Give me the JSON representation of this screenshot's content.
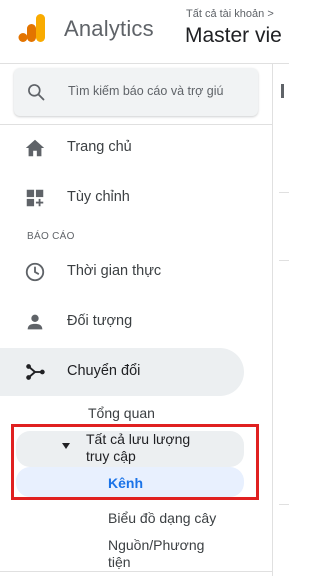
{
  "header": {
    "app_name": "Analytics",
    "account_breadcrumb": "Tất cả tài khoản >",
    "account_name": "Master vie"
  },
  "search": {
    "placeholder": "Tìm kiếm báo cáo và trợ giú",
    "icon": "search-icon"
  },
  "nav": {
    "items": [
      {
        "label": "Trang chủ",
        "icon": "home-icon"
      },
      {
        "label": "Tùy chỉnh",
        "icon": "customize-dashboard-icon"
      }
    ],
    "section_label": "BÁO CÁO",
    "reports": [
      {
        "label": "Thời gian thực",
        "icon": "clock-icon"
      },
      {
        "label": "Đối tượng",
        "icon": "person-icon"
      },
      {
        "label": "Chuyển đổi",
        "icon": "acquisition-icon",
        "active": true
      }
    ]
  },
  "acquisition": {
    "overview": "Tổng quan",
    "all_traffic": "Tất cả lưu lượng truy cập",
    "channels": "Kênh",
    "treemaps": "Biểu đồ dạng cây",
    "source_medium": "Nguồn/Phương tiện"
  },
  "colors": {
    "accent": "#1a73e8",
    "active_bg": "#eceff1",
    "selected_bg": "#e8f0fe",
    "highlight": "#e02020",
    "logo_orange": "#f9ab00",
    "logo_dark_orange": "#e37400"
  }
}
